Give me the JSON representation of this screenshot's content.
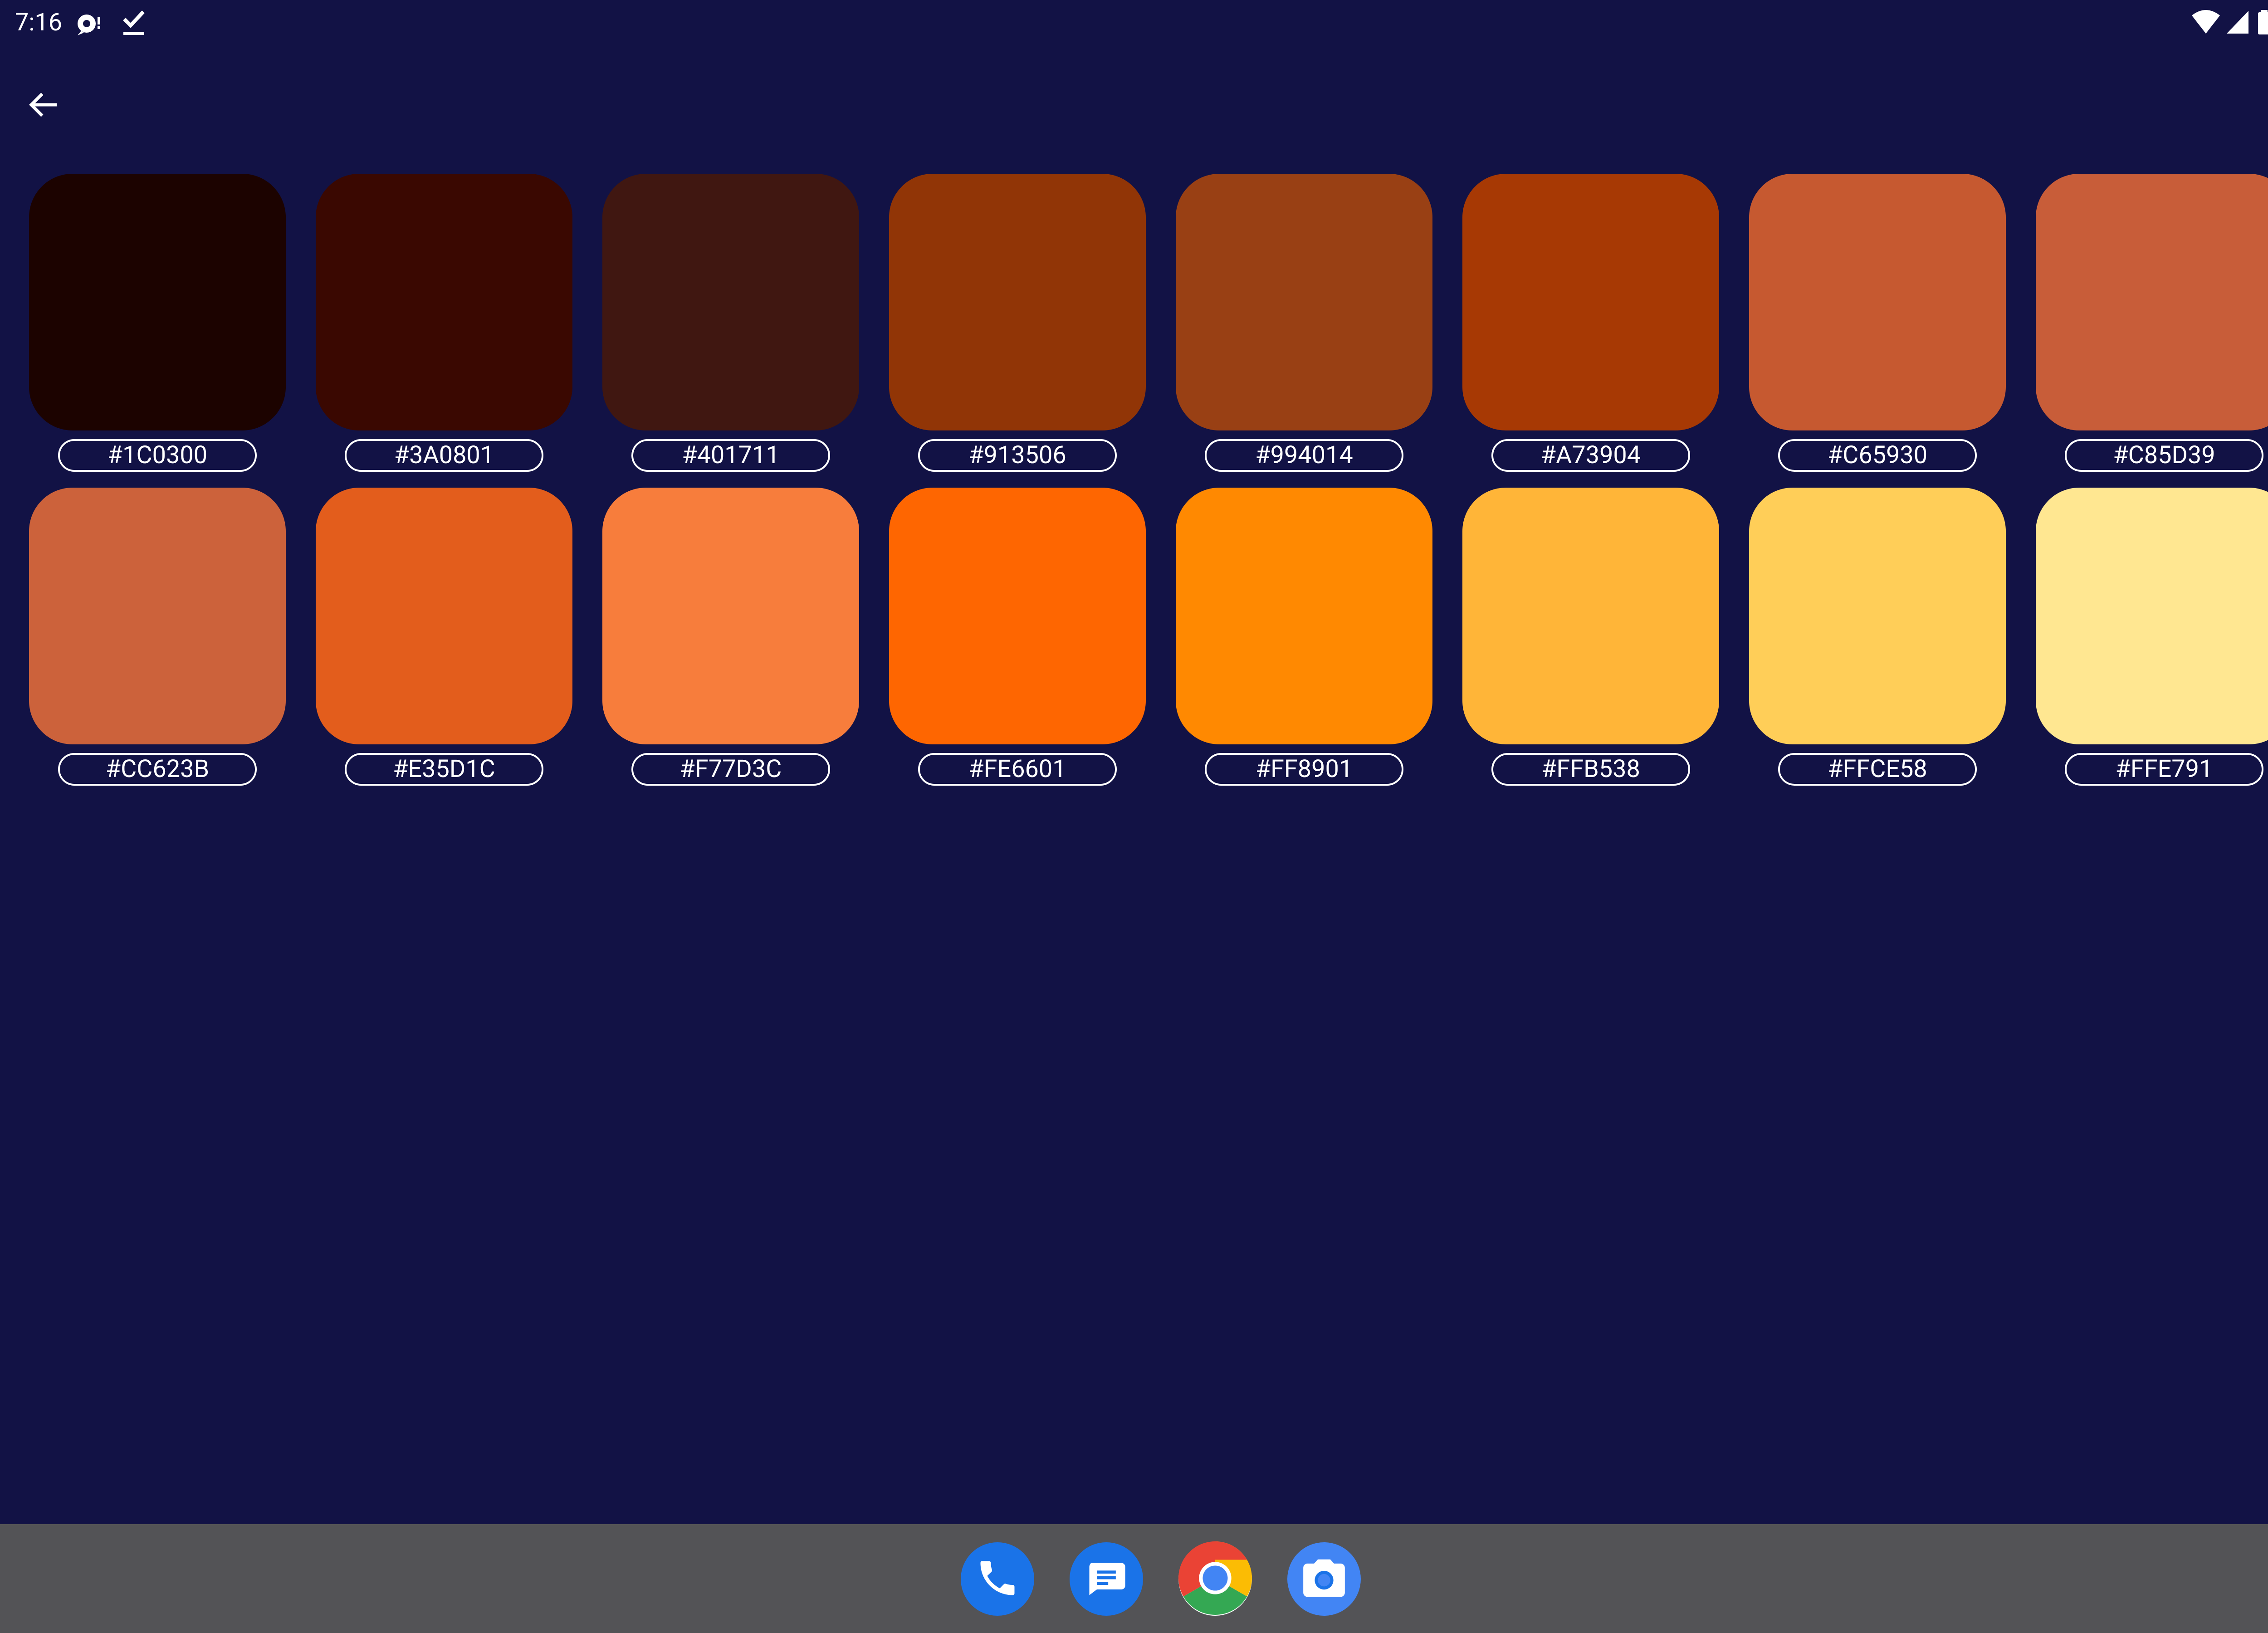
{
  "status_bar": {
    "time": "7:16",
    "icons": [
      "sync-notification-icon",
      "task-done-icon",
      "wifi-icon",
      "cell-signal-icon",
      "battery-icon"
    ]
  },
  "app_bar": {
    "back_icon": "arrow-back-icon"
  },
  "swatches": [
    {
      "hex": "#1C0300",
      "color": "#1C0300"
    },
    {
      "hex": "#3A0801",
      "color": "#3A0801"
    },
    {
      "hex": "#401711",
      "color": "#401711"
    },
    {
      "hex": "#913506",
      "color": "#913506"
    },
    {
      "hex": "#994014",
      "color": "#994014"
    },
    {
      "hex": "#A73904",
      "color": "#A73904"
    },
    {
      "hex": "#C65930",
      "color": "#C65930"
    },
    {
      "hex": "#C85D39",
      "color": "#C85D39"
    },
    {
      "hex": "#CC623B",
      "color": "#CC623B"
    },
    {
      "hex": "#E35D1C",
      "color": "#E35D1C"
    },
    {
      "hex": "#F77D3C",
      "color": "#F77D3C"
    },
    {
      "hex": "#FE6601",
      "color": "#FE6601"
    },
    {
      "hex": "#FF8901",
      "color": "#FF8901"
    },
    {
      "hex": "#FFB538",
      "color": "#FFB538"
    },
    {
      "hex": "#FFCE58",
      "color": "#FFCE58"
    },
    {
      "hex": "#FFE791",
      "color": "#FFE791"
    }
  ],
  "taskbar": {
    "apps": [
      {
        "name": "Phone",
        "icon": "phone-icon"
      },
      {
        "name": "Messages",
        "icon": "messages-icon"
      },
      {
        "name": "Chrome",
        "icon": "chrome-icon"
      },
      {
        "name": "Camera",
        "icon": "camera-icon"
      }
    ]
  },
  "colors": {
    "background": "#121245",
    "taskbar": "#535356",
    "label_text": "#FFFFFF",
    "app_blue": "#1A73E8"
  }
}
